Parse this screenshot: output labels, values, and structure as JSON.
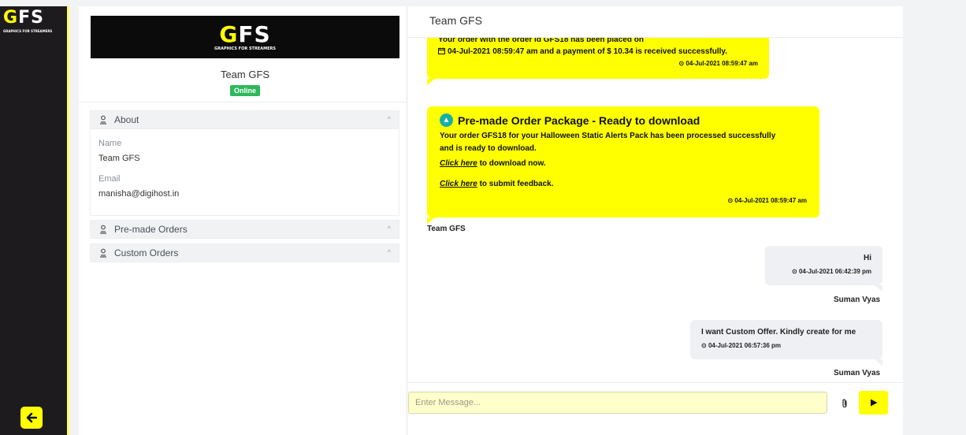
{
  "brand": {
    "logo_text_a": "G",
    "logo_text_b": "FS",
    "tagline": "GRAPHICS FOR STREAMERS",
    "accent": "#ffff00"
  },
  "profile": {
    "name": "Team GFS",
    "status": "Online",
    "sections": [
      {
        "label": "About",
        "fields": [
          {
            "label": "Name",
            "value": "Team GFS"
          },
          {
            "label": "Email",
            "value": "manisha@digihost.in"
          }
        ]
      },
      {
        "label": "Pre-made Orders"
      },
      {
        "label": "Custom Orders"
      }
    ]
  },
  "chat": {
    "title": "Team GFS",
    "messages": [
      {
        "line1": "Your order with the order id GFS18 has been placed on",
        "line2": "04-Jul-2021 08:59:47 am and a payment of $ 10.34 is received successfully.",
        "time": "04-Jul-2021 08:59:47 am"
      },
      {
        "heading": "Pre-made Order Package - Ready to download",
        "line1": "Your order GFS18 for your Halloween Static Alerts Pack has been processed successfully",
        "line2": "and is ready to download.",
        "link1": "Click here",
        "link1_rest": " to download now.",
        "link2": "Click here",
        "link2_rest": " to submit feedback.",
        "time": "04-Jul-2021 08:59:47 am",
        "sender": "Team GFS"
      },
      {
        "text": "Hi",
        "time": "04-Jul-2021 06:42:39 pm",
        "sender": "Suman Vyas"
      },
      {
        "text": "I want Custom Offer. Kindly create for me",
        "time": "04-Jul-2021 06:57:36 pm",
        "sender": "Suman Vyas"
      }
    ],
    "input_placeholder": "Enter Message..."
  }
}
